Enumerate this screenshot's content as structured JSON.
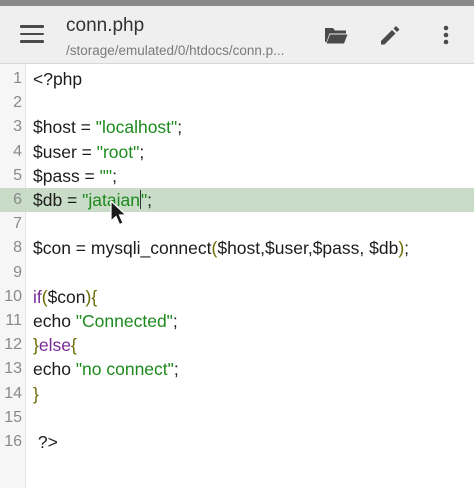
{
  "appbar": {
    "title": "conn.php",
    "path": "/storage/emulated/0/htdocs/conn.p..."
  },
  "icons": {
    "menu": "hamburger-menu-icon",
    "open": "folder-open-icon",
    "edit": "pencil-icon",
    "more": "more-vertical-icon"
  },
  "colors": {
    "string": "#1d8a1d",
    "keyword": "#7a2a99",
    "paren": "#6a6a00",
    "highlight": "#c8dcc8"
  },
  "editor": {
    "highlighted_line": 6,
    "lines": [
      {
        "num": "1",
        "tokens": [
          {
            "t": "<?php",
            "c": "plain"
          }
        ]
      },
      {
        "num": "2",
        "tokens": []
      },
      {
        "num": "3",
        "tokens": [
          {
            "t": "$host = ",
            "c": "plain"
          },
          {
            "t": "\"localhost\"",
            "c": "str"
          },
          {
            "t": ";",
            "c": "plain"
          }
        ]
      },
      {
        "num": "4",
        "tokens": [
          {
            "t": "$user = ",
            "c": "plain"
          },
          {
            "t": "\"root\"",
            "c": "str"
          },
          {
            "t": ";",
            "c": "plain"
          }
        ]
      },
      {
        "num": "5",
        "tokens": [
          {
            "t": "$pass = ",
            "c": "plain"
          },
          {
            "t": "\"\"",
            "c": "str"
          },
          {
            "t": ";",
            "c": "plain"
          }
        ]
      },
      {
        "num": "6",
        "tokens": [
          {
            "t": "$db = ",
            "c": "plain"
          },
          {
            "t": "\"jataian\"",
            "c": "str"
          },
          {
            "t": ";",
            "c": "plain"
          }
        ]
      },
      {
        "num": "7",
        "tokens": []
      },
      {
        "num": "8",
        "tokens": [
          {
            "t": "$con = mysqli_connect",
            "c": "plain"
          },
          {
            "t": "(",
            "c": "p"
          },
          {
            "t": "$host,$user,$pass, $db",
            "c": "plain"
          },
          {
            "t": ")",
            "c": "p"
          },
          {
            "t": ";",
            "c": "plain"
          }
        ]
      },
      {
        "num": "9",
        "tokens": []
      },
      {
        "num": "10",
        "tokens": [
          {
            "t": "if",
            "c": "kw"
          },
          {
            "t": "(",
            "c": "p"
          },
          {
            "t": "$con",
            "c": "plain"
          },
          {
            "t": ")",
            "c": "p"
          },
          {
            "t": "{",
            "c": "p"
          }
        ]
      },
      {
        "num": "11",
        "tokens": [
          {
            "t": "echo ",
            "c": "plain"
          },
          {
            "t": "\"Connected\"",
            "c": "str"
          },
          {
            "t": ";",
            "c": "plain"
          }
        ]
      },
      {
        "num": "12",
        "tokens": [
          {
            "t": "}",
            "c": "p"
          },
          {
            "t": "else",
            "c": "kw"
          },
          {
            "t": "{",
            "c": "p"
          }
        ]
      },
      {
        "num": "13",
        "tokens": [
          {
            "t": "echo ",
            "c": "plain"
          },
          {
            "t": "\"no connect\"",
            "c": "str"
          },
          {
            "t": ";",
            "c": "plain"
          }
        ]
      },
      {
        "num": "14",
        "tokens": [
          {
            "t": "}",
            "c": "p"
          }
        ]
      },
      {
        "num": "15",
        "tokens": []
      },
      {
        "num": "16",
        "tokens": [
          {
            "t": " ?>",
            "c": "plain"
          }
        ]
      }
    ]
  }
}
